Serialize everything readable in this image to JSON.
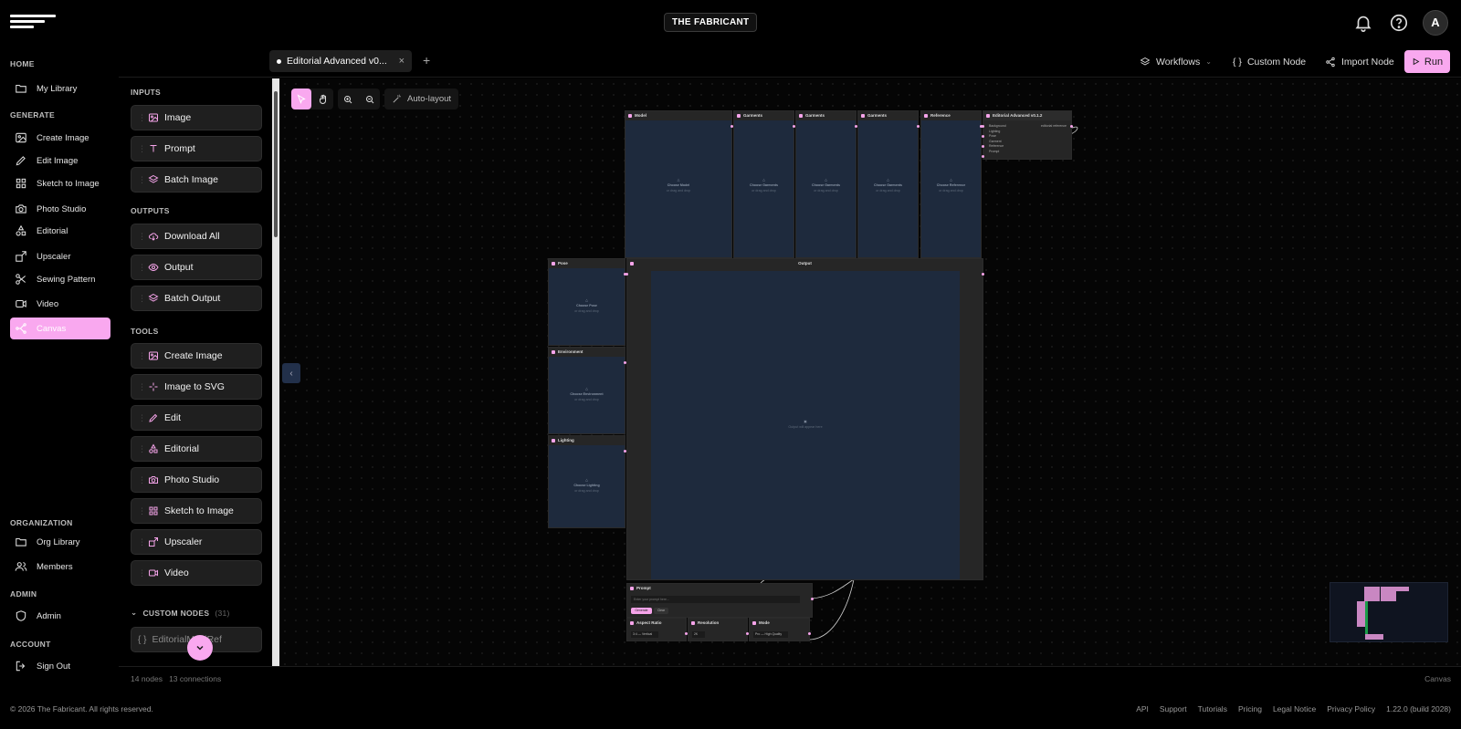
{
  "brand": "THE FABRICANT",
  "avatar_letter": "A",
  "nav": {
    "sections": {
      "home": "HOME",
      "generate": "GENERATE",
      "organization": "ORGANIZATION",
      "admin": "ADMIN",
      "account": "ACCOUNT"
    },
    "items": [
      {
        "label": "My Library",
        "icon": "folder-icon"
      },
      {
        "label": "Create Image",
        "icon": "image-icon"
      },
      {
        "label": "Edit Image",
        "icon": "pencil-icon"
      },
      {
        "label": "Sketch to Image",
        "icon": "grid-icon"
      },
      {
        "label": "Photo Studio",
        "icon": "camera-icon"
      },
      {
        "label": "Editorial",
        "icon": "shapes-icon"
      },
      {
        "label": "Upscaler",
        "icon": "upscale-icon"
      },
      {
        "label": "Sewing Pattern",
        "icon": "scissors-icon"
      },
      {
        "label": "Video",
        "icon": "video-icon"
      },
      {
        "label": "Canvas",
        "icon": "workflow-icon"
      },
      {
        "label": "Org Library",
        "icon": "folder-icon"
      },
      {
        "label": "Members",
        "icon": "users-icon"
      },
      {
        "label": "Admin",
        "icon": "shield-icon"
      },
      {
        "label": "Sign Out",
        "icon": "logout-icon"
      }
    ]
  },
  "tab": {
    "label": "Editorial Advanced v0...",
    "close": "×",
    "add": "+"
  },
  "toolbar": {
    "workflows": "Workflows",
    "custom_node": "Custom Node",
    "import_node": "Import Node",
    "run": "Run",
    "auto_layout": "Auto-layout"
  },
  "palette": {
    "inputs_title": "INPUTS",
    "inputs": [
      "Image",
      "Prompt",
      "Batch Image"
    ],
    "outputs_title": "OUTPUTS",
    "outputs": [
      "Download All",
      "Output",
      "Batch Output"
    ],
    "tools_title": "TOOLS",
    "tools": [
      "Create Image",
      "Image to SVG",
      "Edit",
      "Editorial",
      "Photo Studio",
      "Sketch to Image",
      "Upscaler",
      "Video"
    ],
    "custom_title": "CUSTOM NODES",
    "custom_count": "(31)",
    "custom_items": [
      "EditorialMultiRef"
    ]
  },
  "nodes": {
    "model": {
      "title": "Model",
      "body": "Choose Model"
    },
    "garments1": {
      "title": "Garments",
      "body": "Choose Garments"
    },
    "garments2": {
      "title": "Garments",
      "body": "Choose Garments"
    },
    "garments3": {
      "title": "Garments",
      "body": "Choose Garments"
    },
    "reference": {
      "title": "Reference",
      "body": "Choose Reference"
    },
    "editorial": {
      "title": "Editorial Advanced v0.1.2",
      "rows": [
        "Background",
        "Lighting",
        "Pose",
        "Garment",
        "Reference",
        "Prompt"
      ],
      "out": "editorial reference"
    },
    "pose": {
      "title": "Pose",
      "body": "Choose Pose"
    },
    "environment": {
      "title": "Environment",
      "body": "Choose Environment"
    },
    "lighting": {
      "title": "Lighting",
      "body": "Choose Lighting"
    },
    "output": {
      "title": "Output",
      "body": "Output will appear here"
    },
    "prompt": {
      "title": "Prompt",
      "placeholder": "Enter your prompt here...",
      "chip1": "Generate",
      "chip2": "Clear"
    },
    "aspect": {
      "title": "Aspect Ratio",
      "value": "3:4 — Vertical"
    },
    "resolution": {
      "title": "Resolution",
      "value": "2K"
    },
    "mode": {
      "title": "Mode",
      "value": "Pro — High Quality"
    },
    "sub_hint": "or drag and drop"
  },
  "status": {
    "nodes": "14 nodes",
    "connections": "13 connections",
    "mode": "Canvas"
  },
  "footer": {
    "copyright": "© 2026 The Fabricant. All rights reserved.",
    "links": [
      "API",
      "Support",
      "Tutorials",
      "Pricing",
      "Legal Notice",
      "Privacy Policy"
    ],
    "version": "1.22.0 (build 2028)"
  },
  "colors": {
    "accent": "#f9a8ef",
    "node_body": "#1e2a3d",
    "background": "#000000"
  }
}
